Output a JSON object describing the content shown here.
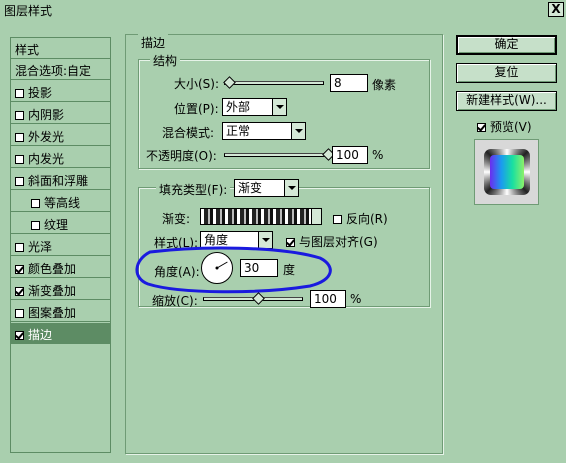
{
  "window": {
    "title": "图层样式",
    "close_label": "X"
  },
  "styles_panel": {
    "header": "样式",
    "items": [
      {
        "label": "混合选项:自定",
        "checkbox": false,
        "checked": false
      },
      {
        "label": "投影",
        "checkbox": true,
        "checked": false
      },
      {
        "label": "内阴影",
        "checkbox": true,
        "checked": false
      },
      {
        "label": "外发光",
        "checkbox": true,
        "checked": false
      },
      {
        "label": "内发光",
        "checkbox": true,
        "checked": false
      },
      {
        "label": "斜面和浮雕",
        "checkbox": true,
        "checked": false
      },
      {
        "label": "等高线",
        "checkbox": true,
        "checked": false
      },
      {
        "label": "纹理",
        "checkbox": true,
        "checked": false
      },
      {
        "label": "光泽",
        "checkbox": true,
        "checked": false
      },
      {
        "label": "颜色叠加",
        "checkbox": true,
        "checked": true
      },
      {
        "label": "渐变叠加",
        "checkbox": true,
        "checked": true
      },
      {
        "label": "图案叠加",
        "checkbox": true,
        "checked": false
      },
      {
        "label": "描边",
        "checkbox": true,
        "checked": true
      }
    ]
  },
  "stroke": {
    "section_title": "描边",
    "structure": {
      "title": "结构",
      "size_label": "大小(S):",
      "size_value": "8",
      "size_unit": "像素",
      "size_level": 0.05,
      "position_label": "位置(P):",
      "position_value": "外部",
      "blend_label": "混合模式:",
      "blend_value": "正常",
      "opacity_label": "不透明度(O):",
      "opacity_value": "100",
      "opacity_unit": "%",
      "opacity_level": 1.0
    },
    "fill": {
      "fill_type_label": "填充类型(F):",
      "fill_type_value": "渐变",
      "gradient_label": "渐变:",
      "reverse_label": "反向(R)",
      "reverse_checked": false,
      "style_label": "样式(L):",
      "style_value": "角度",
      "align_label": "与图层对齐(G)",
      "align_checked": true,
      "angle_label": "角度(A):",
      "angle_value": "30",
      "angle_unit": "度",
      "scale_label": "缩放(C):",
      "scale_value": "100",
      "scale_unit": "%",
      "scale_level": 0.55
    }
  },
  "buttons": {
    "ok": "确定",
    "reset": "复位",
    "new_style": "新建样式(W)...",
    "preview": "预览(V)",
    "preview_checked": true
  },
  "colors": {
    "dialog_bg": "#a9cfae",
    "selected_bg": "#5d8c64",
    "annotation": "#1a1adf"
  }
}
